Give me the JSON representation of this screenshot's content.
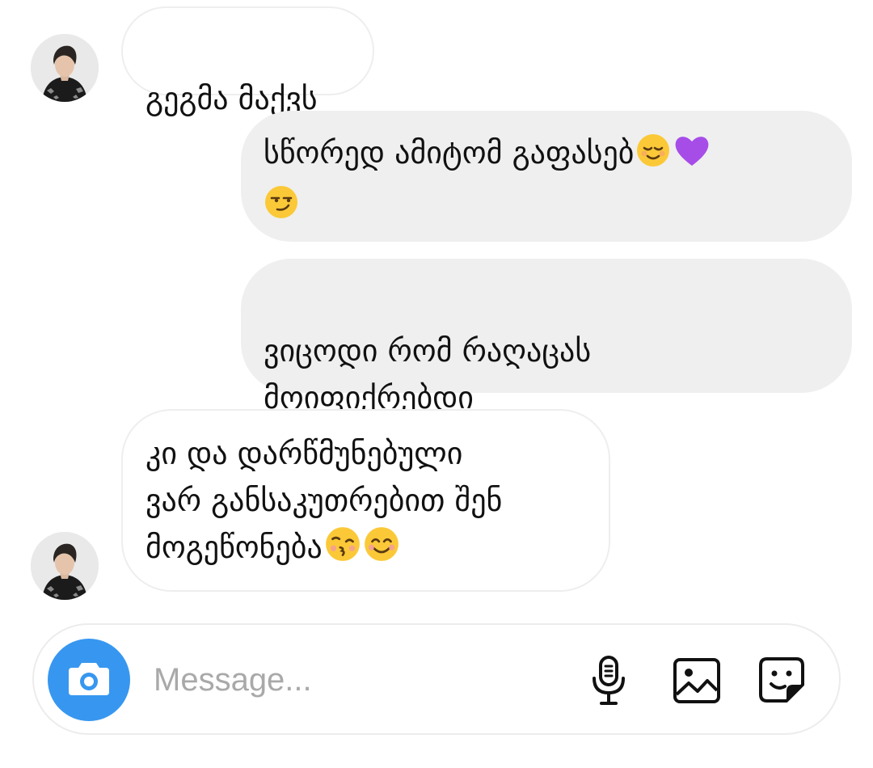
{
  "conversation": {
    "messages": [
      {
        "direction": "incoming",
        "text": "გეგმა მაქვს",
        "emojis": []
      },
      {
        "direction": "outgoing",
        "text": "სწორედ ამიტომ გაფასებ",
        "emojis": [
          "relieved-face",
          "purple-heart",
          "smirking-face"
        ]
      },
      {
        "direction": "outgoing",
        "text": "ვიცოდი რომ რაღაცას\nმოიფიქრებდი",
        "emojis": []
      },
      {
        "direction": "incoming",
        "text": "კი და დარწმუნებული\nვარ განსაკუთრებით შენ\nმოგეწონება",
        "emojis": [
          "kissing-face",
          "smiling-face-with-smiling-eyes"
        ]
      }
    ]
  },
  "composer": {
    "placeholder": "Message...",
    "camera_icon": "camera-icon",
    "tool_icons": [
      "microphone-icon",
      "image-icon",
      "sticker-icon"
    ],
    "accent_color": "#3797f0"
  },
  "colors": {
    "incoming_bubble": "#ffffff",
    "incoming_border": "#eeeeee",
    "outgoing_bubble": "#efefef",
    "text": "#111111",
    "placeholder": "#a9a9a9"
  }
}
